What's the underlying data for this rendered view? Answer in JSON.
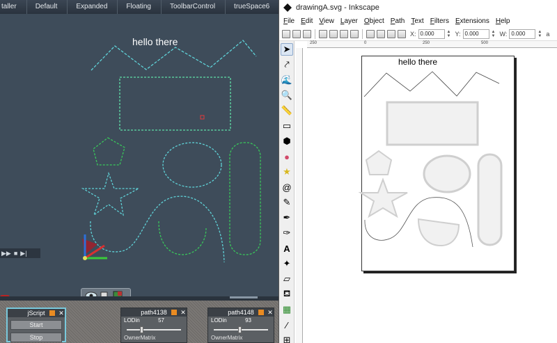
{
  "truespace": {
    "tabs": [
      "taller",
      "Default",
      "Expanded",
      "Floating",
      "ToolbarControl",
      "trueSpace6"
    ],
    "viewport_text": "hello there",
    "panels": {
      "jscript": {
        "title": "jScript",
        "start": "Start",
        "stop": "Stop"
      },
      "path1": {
        "title": "path4138",
        "lod_label": "LODin",
        "lod_value": "57",
        "lod": 0.27,
        "owner": "OwnerMatrix"
      },
      "path2": {
        "title": "path4148",
        "lod_label": "LODin",
        "lod_value": "93",
        "lod": 0.47,
        "owner": "OwnerMatrix"
      }
    },
    "colors": {
      "viewport_bg": "#3e4c5a",
      "cyan": "#5fd2d8",
      "green": "#39c85a",
      "accent": "#e98b22"
    }
  },
  "inkscape": {
    "title": "drawingA.svg - Inkscape",
    "menu": [
      {
        "label": "File",
        "u": "F",
        "rest": "ile"
      },
      {
        "label": "Edit",
        "u": "E",
        "rest": "dit"
      },
      {
        "label": "View",
        "u": "V",
        "rest": "iew"
      },
      {
        "label": "Layer",
        "u": "L",
        "rest": "ayer"
      },
      {
        "label": "Object",
        "u": "O",
        "rest": "bject"
      },
      {
        "label": "Path",
        "u": "P",
        "rest": "ath"
      },
      {
        "label": "Text",
        "u": "T",
        "rest": "ext"
      },
      {
        "label": "Filters",
        "u": "F",
        "rest": "ilters"
      },
      {
        "label": "Extensions",
        "u": "E",
        "rest": "xtensions"
      },
      {
        "label": "Help",
        "u": "H",
        "rest": "elp"
      }
    ],
    "coords": {
      "x_label": "X:",
      "x": "0.000",
      "y_label": "Y:",
      "y": "0.000",
      "w_label": "W:",
      "w": "0.000"
    },
    "ruler_marks": [
      "250",
      "0",
      "250",
      "500"
    ],
    "canvas_text": "hello there",
    "tools": [
      "select-arrow",
      "node-editor",
      "tweak",
      "zoom",
      "measure",
      "rectangle",
      "3d-box",
      "ellipse",
      "star",
      "spiral",
      "pencil",
      "pen",
      "calligraphy",
      "text",
      "spray",
      "eraser",
      "bucket",
      "gradient",
      "mesh",
      "dropper",
      "connector"
    ]
  }
}
